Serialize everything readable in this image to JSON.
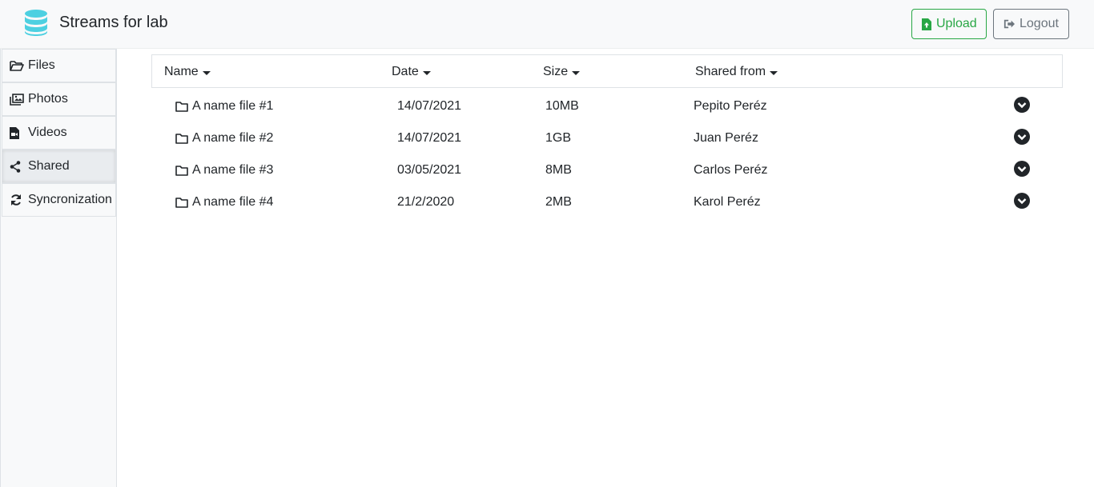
{
  "app": {
    "title": "Streams for lab",
    "brand_color": "#4dd0e1"
  },
  "header": {
    "upload_label": "Upload",
    "logout_label": "Logout",
    "upload_color": "#28a745",
    "logout_color": "#6c757d"
  },
  "sidebar": {
    "active": "Shared",
    "items": [
      {
        "label": "Files",
        "icon": "folder-open-icon"
      },
      {
        "label": "Photos",
        "icon": "images-icon"
      },
      {
        "label": "Videos",
        "icon": "file-video-icon"
      },
      {
        "label": "Shared",
        "icon": "share-icon"
      },
      {
        "label": "Syncronization",
        "icon": "sync-icon"
      }
    ]
  },
  "table": {
    "columns": [
      "Name",
      "Date",
      "Size",
      "Shared from"
    ],
    "rows": [
      {
        "name": "A name file #1",
        "date": "14/07/2021",
        "size": "10MB",
        "shared_from": "Pepito Peréz"
      },
      {
        "name": "A name file #2",
        "date": "14/07/2021",
        "size": "1GB",
        "shared_from": "Juan Peréz"
      },
      {
        "name": "A name file #3",
        "date": "03/05/2021",
        "size": "8MB",
        "shared_from": "Carlos Peréz"
      },
      {
        "name": "A name file #4",
        "date": "21/2/2020",
        "size": "2MB",
        "shared_from": "Karol Peréz"
      }
    ]
  }
}
